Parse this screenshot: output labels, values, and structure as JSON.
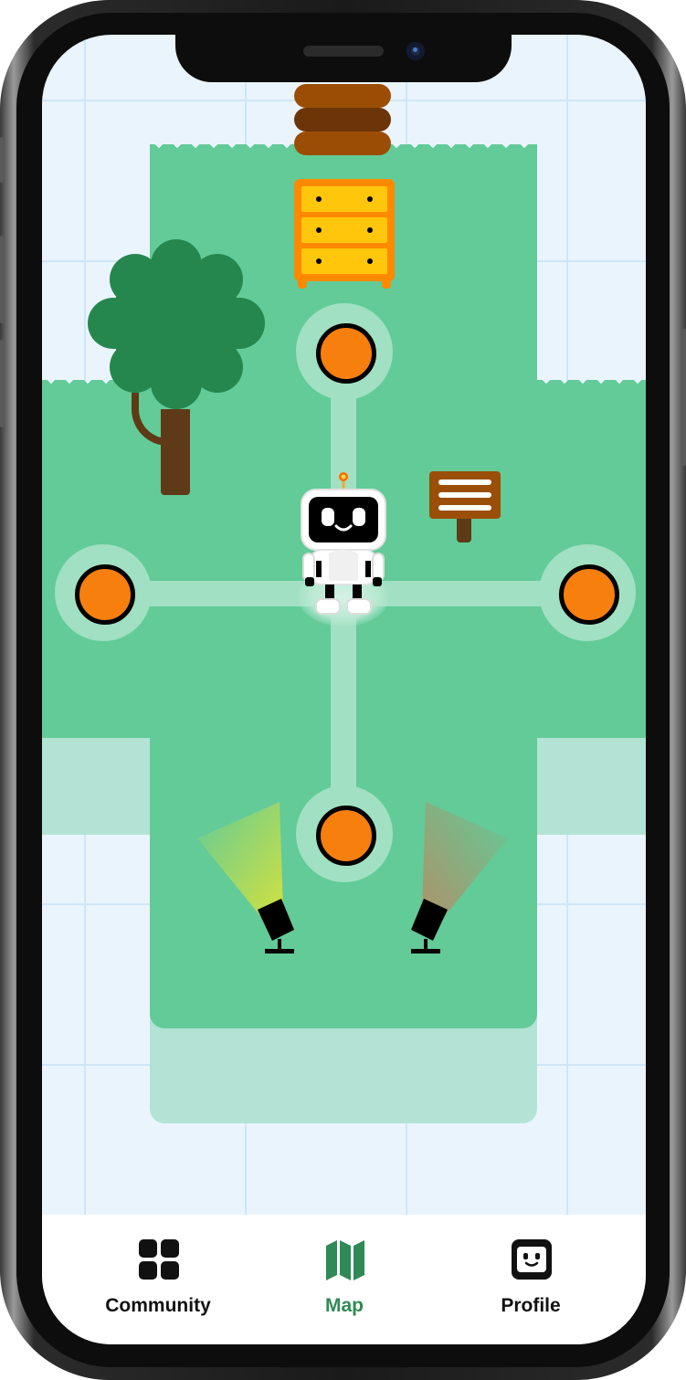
{
  "tabbar": {
    "tabs": [
      {
        "label": "Community",
        "icon": "grid-icon",
        "active": false
      },
      {
        "label": "Map",
        "icon": "map-icon",
        "active": true
      },
      {
        "label": "Profile",
        "icon": "robot-face-icon",
        "active": false
      }
    ]
  },
  "colors": {
    "background": "#eaf4fd",
    "grass": "#62cb98",
    "path": "#a1e0c2",
    "node": "#f77f0e",
    "active_tab": "#2f8a55"
  }
}
